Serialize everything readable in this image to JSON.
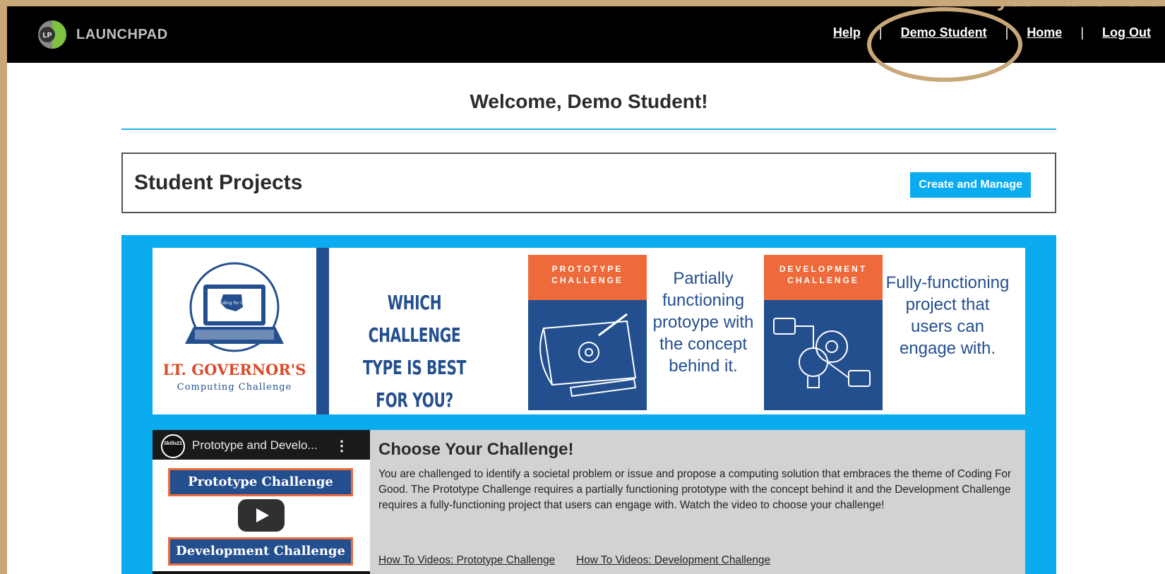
{
  "annotation": {
    "text": "Click on your name here",
    "color": "#c9a778"
  },
  "header": {
    "logo_badge": "LP",
    "app_name": "LAUNCHPAD",
    "nav": {
      "help": "Help",
      "user": "Demo Student",
      "home": "Home",
      "logout": "Log Out",
      "separator": "|"
    }
  },
  "welcome": {
    "title": "Welcome, Demo Student!"
  },
  "projects": {
    "title": "Student Projects",
    "button": "Create and Manage"
  },
  "banner": {
    "logo_title": "LT. GOVERNOR'S",
    "logo_subtitle": "Computing Challenge",
    "logo_screen_text": "Coding for Good",
    "question": "WHICH CHALLENGE TYPE IS BEST FOR YOU?",
    "prototype": {
      "head": "PROTOTYPE CHALLENGE",
      "desc": "Partially functioning protoype with the concept behind it."
    },
    "development": {
      "head": "DEVELOPMENT CHALLENGE",
      "desc": "Fully-functioning project that users can engage with."
    }
  },
  "video": {
    "channel": "Skills21",
    "title": "Prototype and Develo...",
    "bar1": "Prototype Challenge",
    "bar2": "Development Challenge"
  },
  "challenge": {
    "title": "Choose Your Challenge!",
    "body": "You are challenged to identify a societal problem or issue and propose a computing solution that embraces the theme of Coding For Good. The Prototype Challenge requires a partially functioning prototype with the concept behind it and the Development Challenge requires a fully-functioning project that users can engage with. Watch the video to choose your challenge!",
    "link_prototype": "How To Videos: Prototype Challenge",
    "link_development": "How To Videos: Development Challenge"
  },
  "colors": {
    "accent_blue": "#0aabef",
    "navy": "#244f8f",
    "orange": "#ee6a3a",
    "annotation_tan": "#c9a778"
  }
}
